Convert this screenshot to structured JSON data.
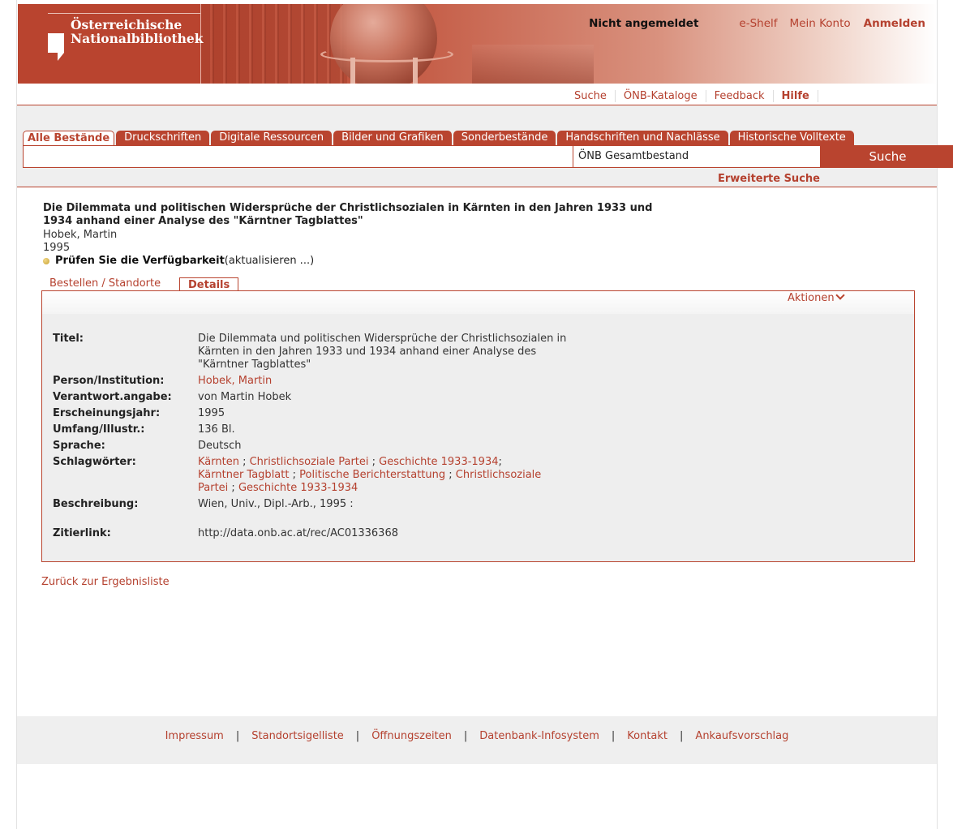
{
  "header": {
    "logo_line1": "Österreichische",
    "logo_line2": "Nationalbibliothek",
    "status": "Nicht angemeldet",
    "links": [
      "e-Shelf",
      "Mein Konto"
    ],
    "login": "Anmelden"
  },
  "util_nav": [
    "Suche",
    "ÖNB-Kataloge",
    "Feedback",
    "Hilfe"
  ],
  "search": {
    "tabs": [
      "Alle Bestände",
      "Druckschriften",
      "Digitale Ressourcen",
      "Bilder und Grafiken",
      "Sonderbestände",
      "Handschriften und Nachlässe",
      "Historische Volltexte"
    ],
    "query": "",
    "scope": "ÖNB Gesamtbestand",
    "button": "Suche",
    "advanced": "Erweiterte Suche"
  },
  "record": {
    "title": "Die Dilemmata und politischen Widersprüche der Christlichsozialen in Kärnten in den Jahren 1933 und 1934 anhand einer Analyse des \"Kärntner Tagblattes\"",
    "author": "Hobek, Martin",
    "year": "1995",
    "availability_label": "Prüfen Sie die Verfügbarkeit",
    "availability_note": "(aktualisieren ...)"
  },
  "detail_tabs": {
    "order": "Bestellen / Standorte",
    "details": "Details"
  },
  "actions": "Aktionen",
  "fields": {
    "title_label": "Titel:",
    "title_value": "Die Dilemmata und politischen Widersprüche der Christlichsozialen in Kärnten in den Jahren 1933 und 1934 anhand einer Analyse des \"Kärntner Tagblattes\"",
    "person_label": "Person/Institution:",
    "person_value": "Hobek, Martin",
    "resp_label": "Verantwort.angabe:",
    "resp_value": "von Martin Hobek",
    "year_label": "Erscheinungsjahr:",
    "year_value": "1995",
    "extent_label": "Umfang/Illustr.:",
    "extent_value": "136 Bl.",
    "lang_label": "Sprache:",
    "lang_value": "Deutsch",
    "subjects_label": "Schlagwörter:",
    "subjects": [
      "Kärnten",
      "Christlichsoziale Partei",
      "Geschichte 1933-1934",
      "Kärntner Tagblatt",
      "Politische Berichterstattung",
      "Christlichsoziale Partei",
      "Geschichte 1933-1934"
    ],
    "desc_label": "Beschreibung:",
    "desc_value": "Wien, Univ., Dipl.-Arb., 1995 :",
    "cite_label": "Zitierlink:",
    "cite_value": "http://data.onb.ac.at/rec/AC01336368"
  },
  "back_link": "Zurück zur Ergebnisliste",
  "footer": [
    "Impressum",
    "Standortsigelliste",
    "Öffnungszeiten",
    "Datenbank-Infosystem",
    "Kontakt",
    "Ankaufsvorschlag"
  ],
  "colors": {
    "brand": "#b9442f",
    "panel": "#eeeeee"
  }
}
